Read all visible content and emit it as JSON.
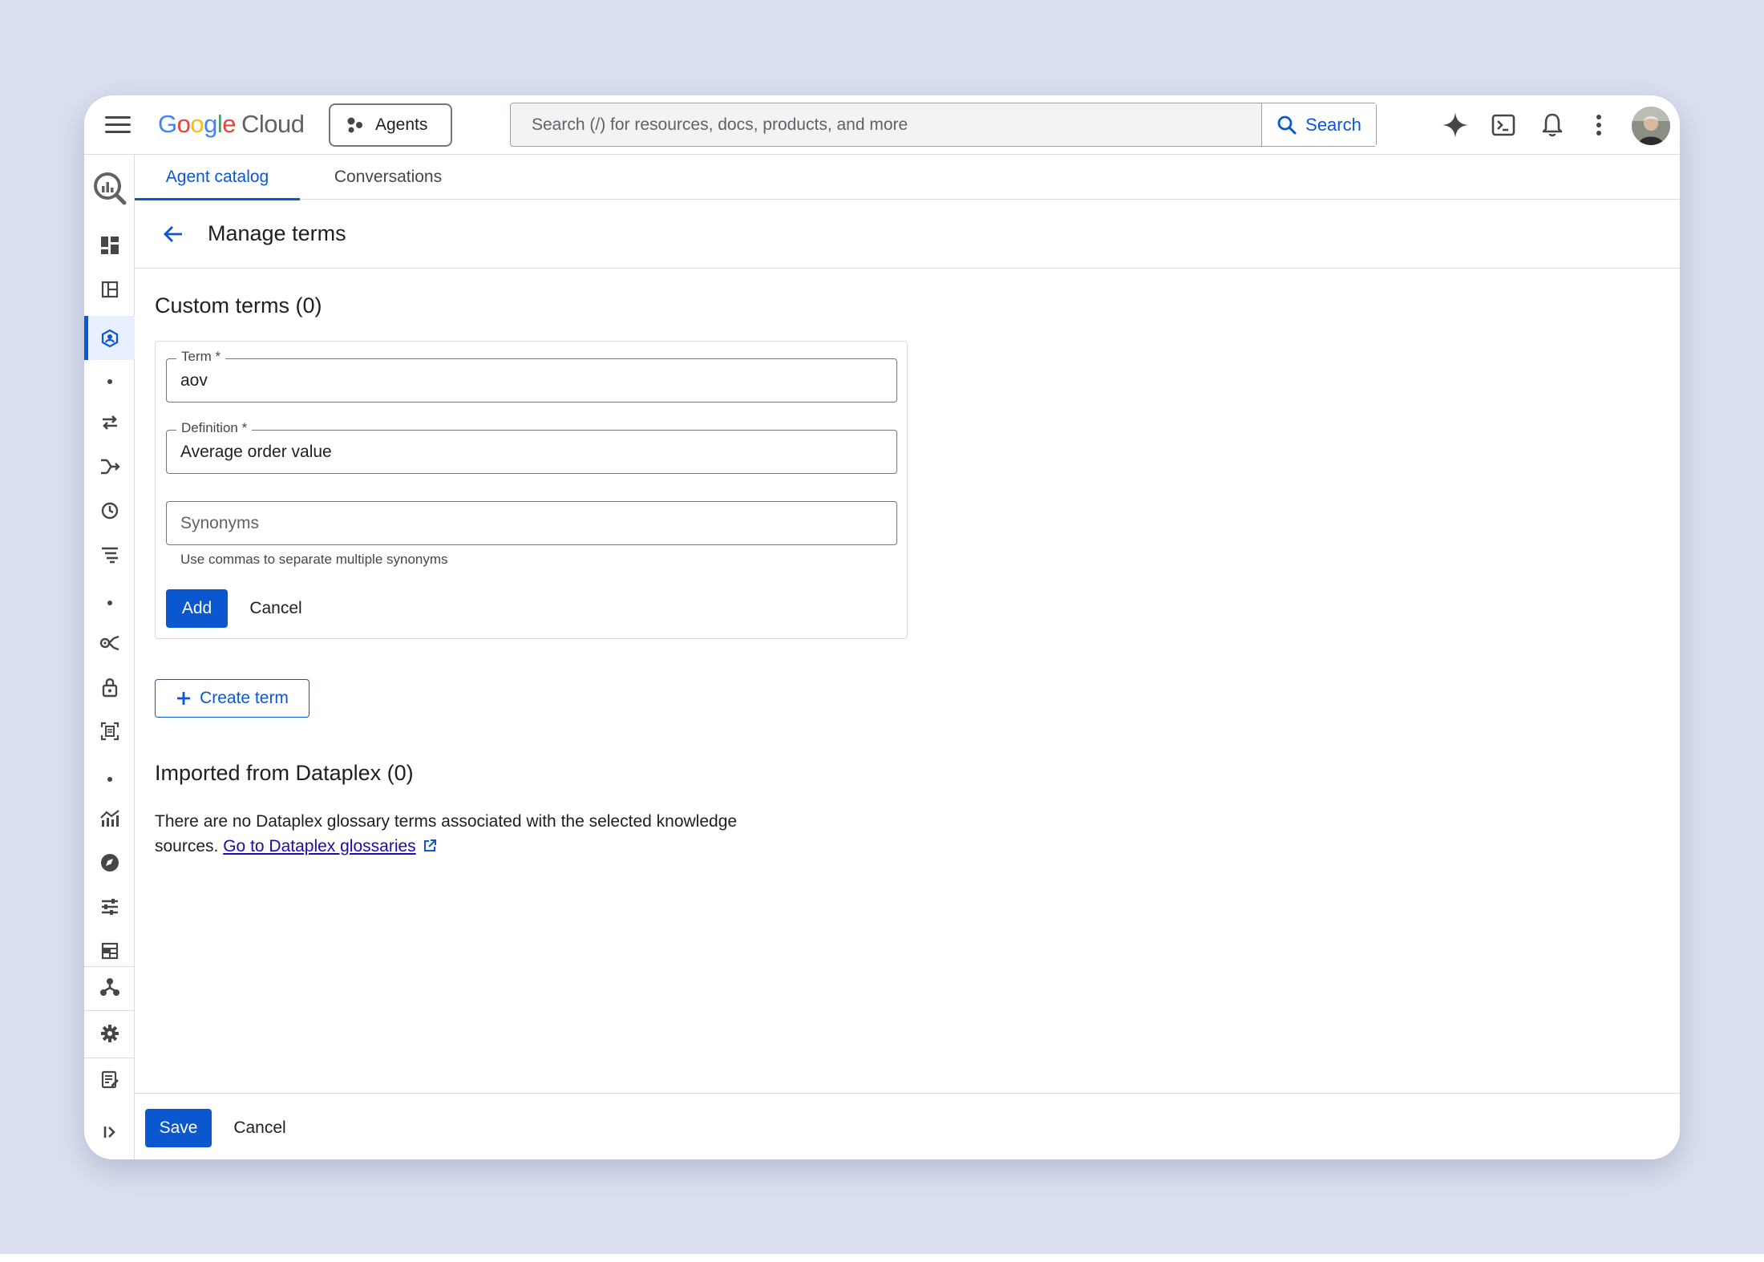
{
  "topbar": {
    "logo_google": "Google",
    "logo_cloud": "Cloud",
    "agents_label": "Agents",
    "search_placeholder": "Search (/) for resources, docs, products, and more",
    "search_button": "Search",
    "icons": [
      "menu-icon",
      "gemini-spark-icon",
      "cloud-shell-icon",
      "bell-icon",
      "more-vert-icon",
      "avatar"
    ]
  },
  "tabs": [
    {
      "label": "Agent catalog",
      "active": true
    },
    {
      "label": "Conversations",
      "active": false
    }
  ],
  "page": {
    "title": "Manage terms"
  },
  "custom_terms": {
    "heading": "Custom terms (0)",
    "term_label": "Term *",
    "term_value": "aov",
    "definition_label": "Definition *",
    "definition_value": "Average order value",
    "synonyms_placeholder": "Synonyms",
    "synonyms_hint": "Use commas to separate multiple synonyms",
    "add_label": "Add",
    "cancel_label": "Cancel",
    "create_label": "Create term"
  },
  "imported": {
    "heading": "Imported from Dataplex (0)",
    "message": "There are no Dataplex glossary terms associated with the selected knowledge sources.",
    "link": "Go to Dataplex glossaries"
  },
  "footer": {
    "save_label": "Save",
    "cancel_label": "Cancel"
  },
  "colors": {
    "accent": "#0b57d0",
    "background": "#dbe0f1",
    "link": "#1a0dab"
  }
}
